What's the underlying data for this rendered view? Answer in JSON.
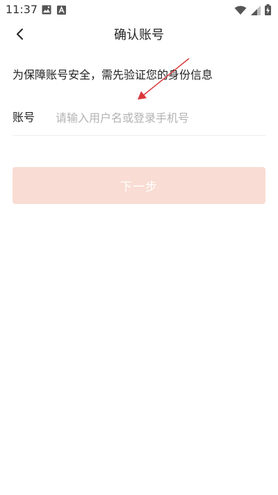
{
  "status_bar": {
    "time": "11:37"
  },
  "header": {
    "title": "确认账号"
  },
  "main": {
    "info_text": "为保障账号安全，需先验证您的身份信息",
    "account": {
      "label": "账号",
      "placeholder": "请输入用户名或登录手机号",
      "value": ""
    },
    "next_button": {
      "label": "下一步"
    }
  },
  "colors": {
    "next_button_bg": "#f9dcd3",
    "annotation_arrow": "#d9373b"
  },
  "icons": {
    "status_left": [
      "image-icon",
      "a-badge-icon"
    ],
    "status_right": [
      "wifi-icon",
      "signal-icon",
      "battery-charging-icon"
    ],
    "back": "chevron-left-icon"
  }
}
